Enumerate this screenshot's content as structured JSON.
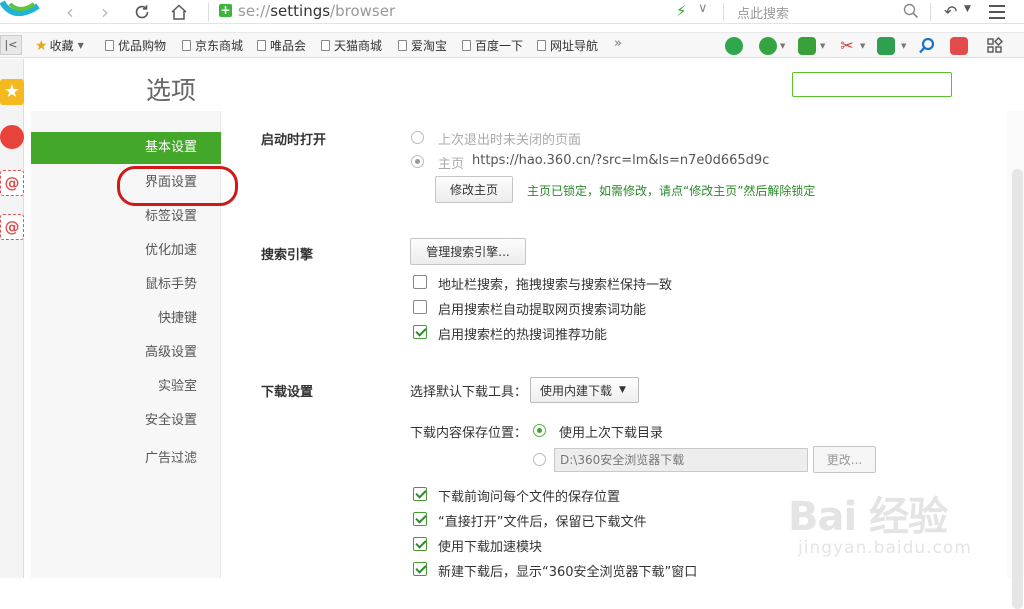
{
  "address_bar": {
    "url_prefix": "se://",
    "url_path": "settings",
    "url_suffix": "/browser",
    "search_placeholder": "点此搜索"
  },
  "bookmarks": {
    "items": [
      {
        "label": "收藏",
        "type": "favorites"
      },
      {
        "label": "优品购物"
      },
      {
        "label": "京东商城"
      },
      {
        "label": "唯品会"
      },
      {
        "label": "天猫商城"
      },
      {
        "label": "爱淘宝"
      },
      {
        "label": "百度一下"
      },
      {
        "label": "网址导航"
      }
    ],
    "more": "»"
  },
  "page": {
    "title": "选项",
    "nav": [
      {
        "label": "基本设置",
        "active": true
      },
      {
        "label": "界面设置"
      },
      {
        "label": "标签设置"
      },
      {
        "label": "优化加速"
      },
      {
        "label": "鼠标手势"
      },
      {
        "label": "快捷键"
      },
      {
        "label": "高级设置"
      },
      {
        "label": "实验室"
      },
      {
        "label": "安全设置"
      },
      {
        "label": "广告过滤"
      }
    ]
  },
  "startup": {
    "title": "启动时打开",
    "option_last": "上次退出时未关闭的页面",
    "option_home_label": "主页",
    "home_url": "https://hao.360.cn/?src=lm&ls=n7e0d665d9c",
    "modify_button": "修改主页",
    "lock_notice": "主页已锁定，如需修改，请点“修改主页”然后解除锁定"
  },
  "search_engine": {
    "title": "搜索引擎",
    "manage_button": "管理搜索引擎...",
    "options": [
      {
        "label": "地址栏搜索，拖拽搜索与搜索栏保持一致",
        "checked": false
      },
      {
        "label": "启用搜索栏自动提取网页搜索词功能",
        "checked": false
      },
      {
        "label": "启用搜索栏的热搜词推荐功能",
        "checked": true
      }
    ]
  },
  "download": {
    "title": "下载设置",
    "tool_label": "选择默认下载工具：",
    "tool_value": "使用内建下载",
    "location_label": "下载内容保存位置：",
    "location_last": "使用上次下载目录",
    "location_path": "D:\\360安全浏览器下载",
    "change_button": "更改...",
    "options": [
      {
        "label": "下载前询问每个文件的保存位置",
        "checked": true
      },
      {
        "label": "“直接打开”文件后，保留已下载文件",
        "checked": true
      },
      {
        "label": "使用下载加速模块",
        "checked": true
      },
      {
        "label": "新建下载后，显示“360安全浏览器下载”窗口",
        "checked": true
      }
    ]
  },
  "watermark": {
    "main": "Bai 经验",
    "sub": "jingyan.baidu.com"
  },
  "colors": {
    "accent": "#43a72a",
    "highlight": "#d01a1a"
  }
}
